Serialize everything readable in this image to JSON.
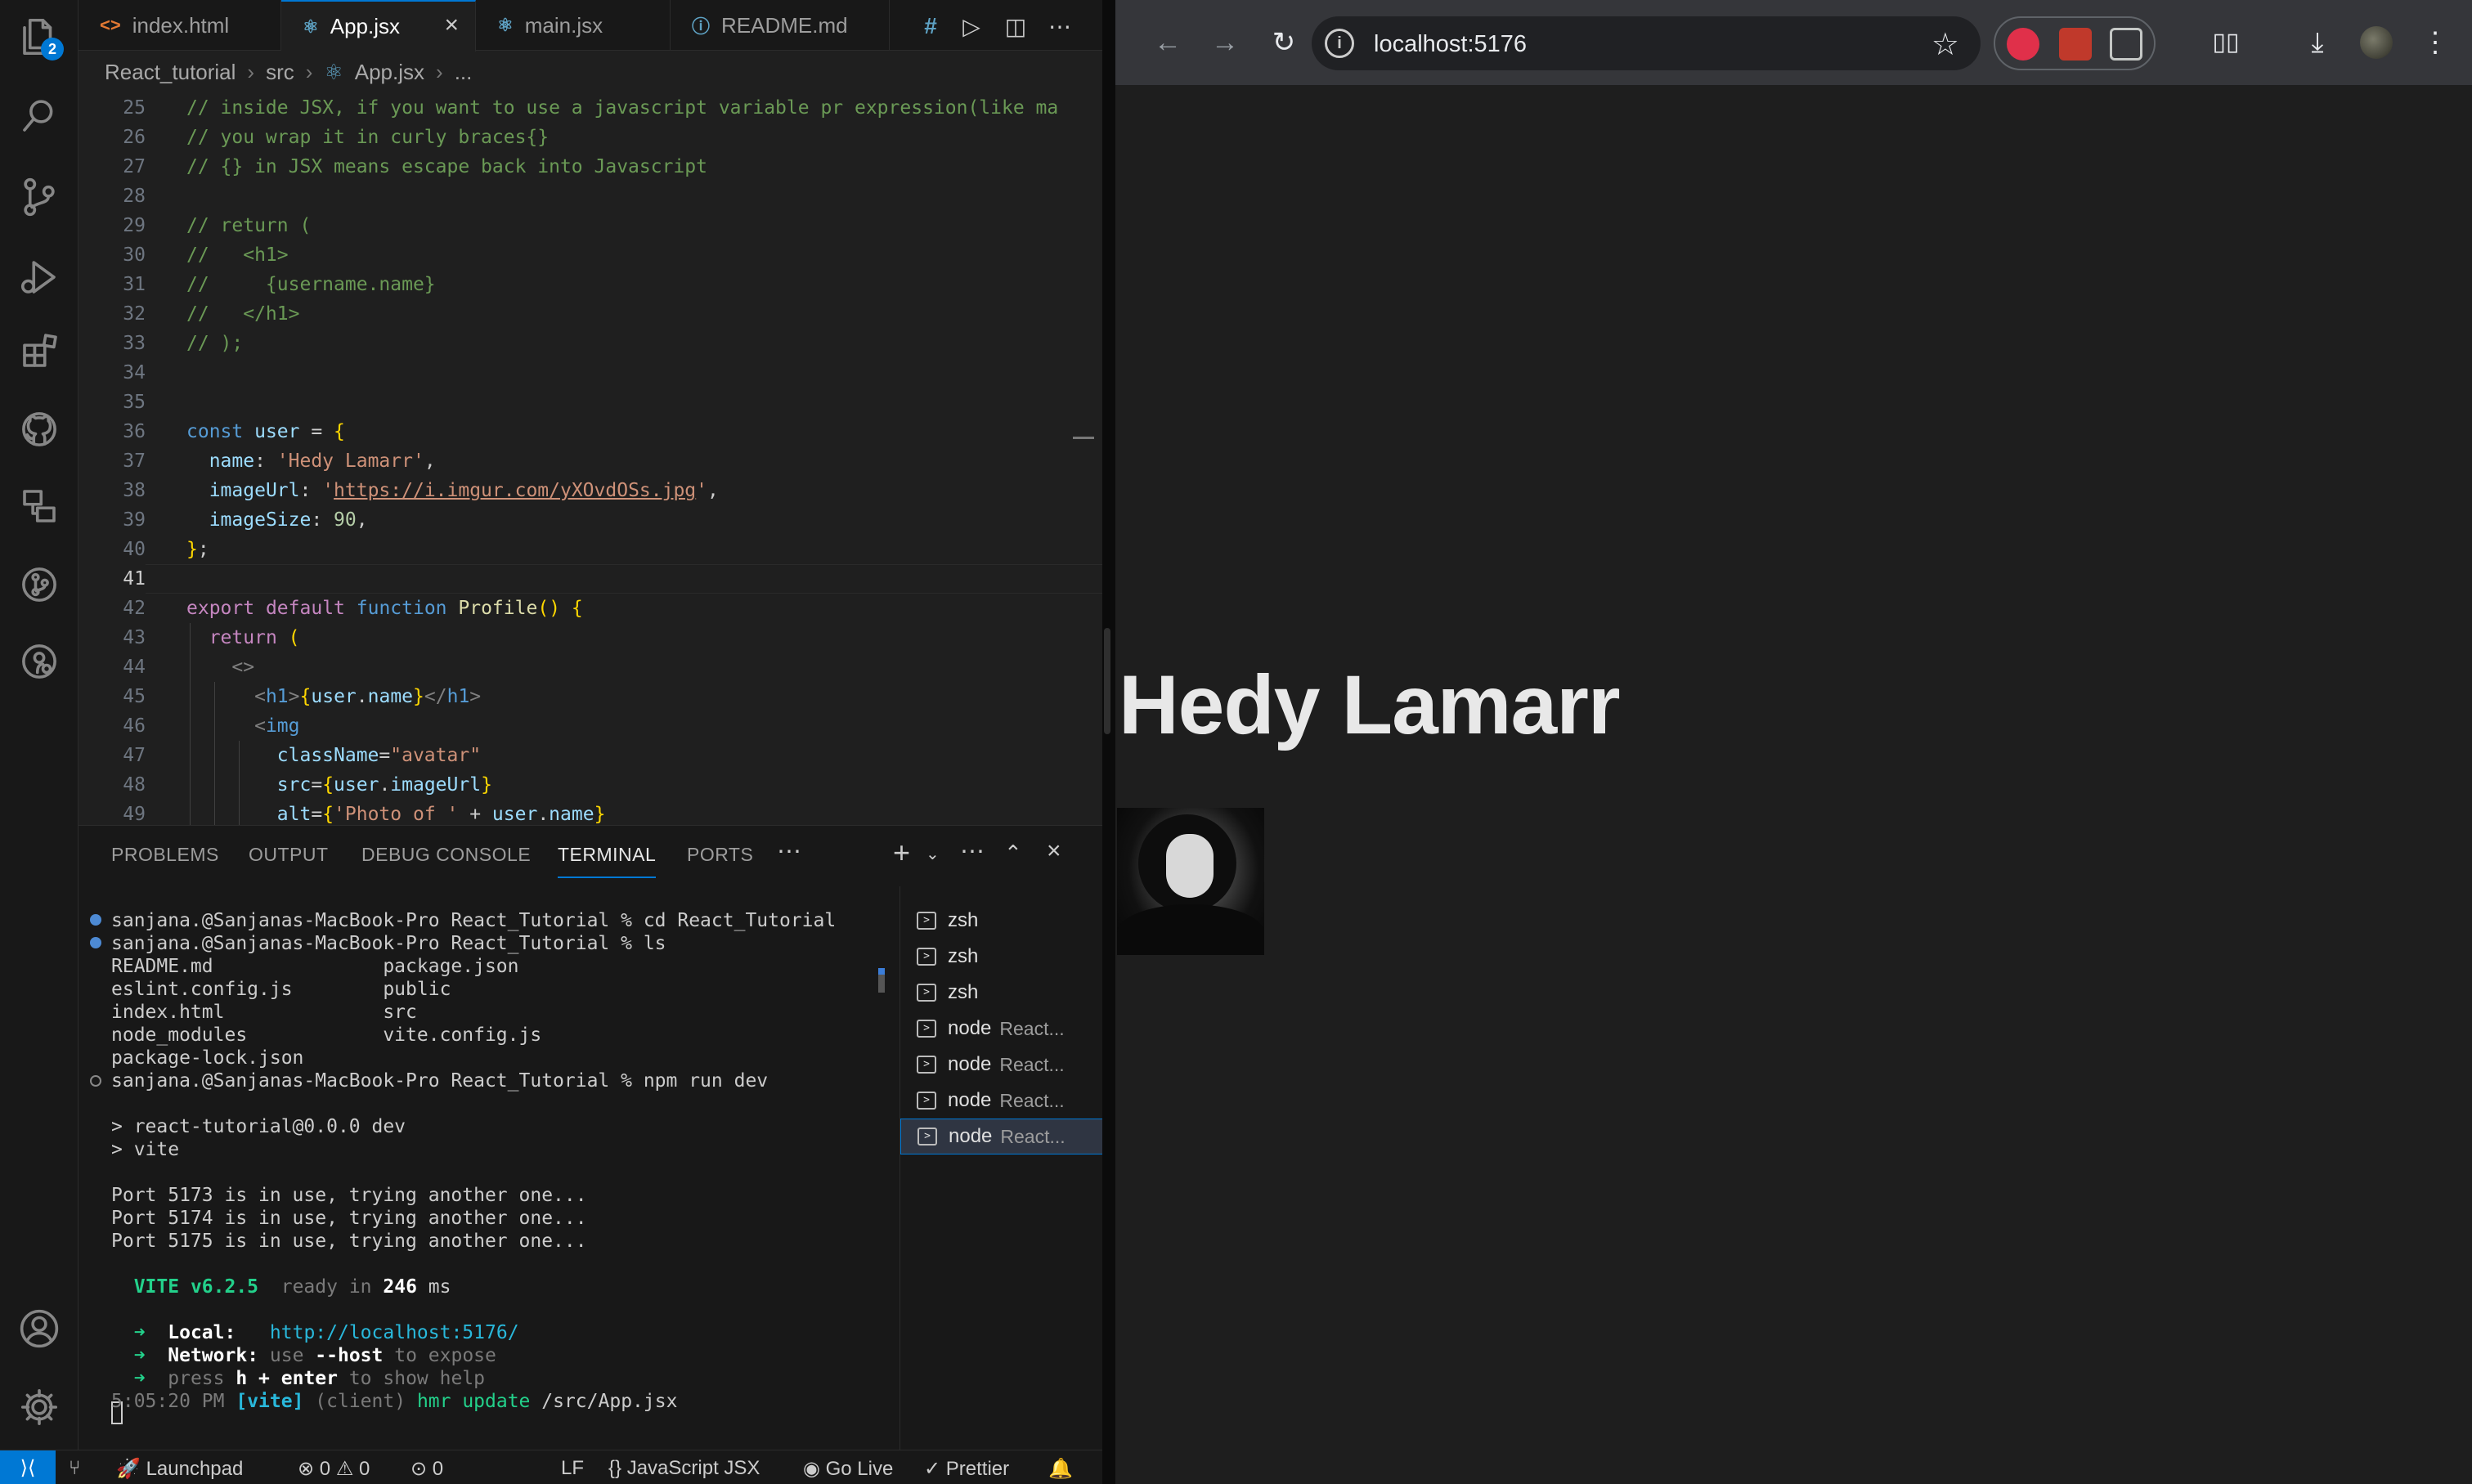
{
  "vscode": {
    "explorer_badge": "2",
    "tabs": [
      {
        "label": "index.html",
        "icon": "<>"
      },
      {
        "label": "App.jsx",
        "icon": "⚛"
      },
      {
        "label": "main.jsx",
        "icon": "⚛"
      },
      {
        "label": "README.md",
        "icon": "ⓘ"
      }
    ],
    "tab_actions": [
      "#",
      "▷",
      "◫",
      "⋯"
    ],
    "breadcrumb": [
      "React_tutorial",
      "src",
      "App.jsx",
      "..."
    ],
    "editor": {
      "current_line": "41",
      "lines": [
        {
          "n": "25",
          "text": "// inside JSX, if you want to use a javascript variable pr expression(like ma"
        },
        {
          "n": "26",
          "text": "// you wrap it in curly braces{}"
        },
        {
          "n": "27",
          "text": "// {} in JSX means escape back into Javascript"
        },
        {
          "n": "28",
          "text": ""
        },
        {
          "n": "29",
          "text": "// return ("
        },
        {
          "n": "30",
          "text": "//   <h1>"
        },
        {
          "n": "31",
          "text": "//     {username.name}"
        },
        {
          "n": "32",
          "text": "//   </h1>"
        },
        {
          "n": "33",
          "text": "// );"
        },
        {
          "n": "34",
          "text": ""
        },
        {
          "n": "35",
          "text": ""
        },
        {
          "n": "36",
          "text": "const user = {"
        },
        {
          "n": "37",
          "text": "  name: 'Hedy Lamarr',"
        },
        {
          "n": "38",
          "text": "  imageUrl: 'https://i.imgur.com/yXOvdOSs.jpg',"
        },
        {
          "n": "39",
          "text": "  imageSize: 90,"
        },
        {
          "n": "40",
          "text": "};"
        },
        {
          "n": "41",
          "text": ""
        },
        {
          "n": "42",
          "text": "export default function Profile() {"
        },
        {
          "n": "43",
          "text": "  return ("
        },
        {
          "n": "44",
          "text": "    <>"
        },
        {
          "n": "45",
          "text": "      <h1>{user.name}</h1>"
        },
        {
          "n": "46",
          "text": "      <img"
        },
        {
          "n": "47",
          "text": "        className=\"avatar\""
        },
        {
          "n": "48",
          "text": "        src={user.imageUrl}"
        },
        {
          "n": "49",
          "text": "        alt={'Photo of ' + user.name}"
        }
      ]
    },
    "panel": {
      "tabs": [
        "PROBLEMS",
        "OUTPUT",
        "DEBUG CONSOLE",
        "TERMINAL",
        "PORTS"
      ],
      "active_tab": "TERMINAL",
      "terminal_lines": [
        "sanjana.@Sanjanas-MacBook-Pro React_Tutorial % cd React_Tutorial",
        "sanjana.@Sanjanas-MacBook-Pro React_Tutorial % ls",
        "README.md               package.json",
        "eslint.config.js        public",
        "index.html              src",
        "node_modules            vite.config.js",
        "package-lock.json",
        "sanjana.@Sanjanas-MacBook-Pro React_Tutorial % npm run dev",
        "",
        "> react-tutorial@0.0.0 dev",
        "> vite",
        "",
        "Port 5173 is in use, trying another one...",
        "Port 5174 is in use, trying another one...",
        "Port 5175 is in use, trying another one...",
        "",
        "  VITE v6.2.5  ready in 246 ms",
        "",
        "  ➜  Local:   http://localhost:5176/",
        "  ➜  Network: use --host to expose",
        "  ➜  press h + enter to show help",
        "5:05:20 PM [vite] (client) hmr update /src/App.jsx"
      ],
      "terminals": [
        {
          "name": "zsh",
          "sub": ""
        },
        {
          "name": "zsh",
          "sub": ""
        },
        {
          "name": "zsh",
          "sub": ""
        },
        {
          "name": "node",
          "sub": "React..."
        },
        {
          "name": "node",
          "sub": "React..."
        },
        {
          "name": "node",
          "sub": "React..."
        },
        {
          "name": "node",
          "sub": "React..."
        }
      ]
    },
    "status": {
      "launchpad": "Launchpad",
      "errors": "0",
      "warnings": "0",
      "ports": "0",
      "eol": "LF",
      "language": "JavaScript JSX",
      "golive": "Go Live",
      "prettier": "Prettier"
    }
  },
  "browser": {
    "url": "localhost:5176",
    "page_heading": "Hedy Lamarr"
  }
}
